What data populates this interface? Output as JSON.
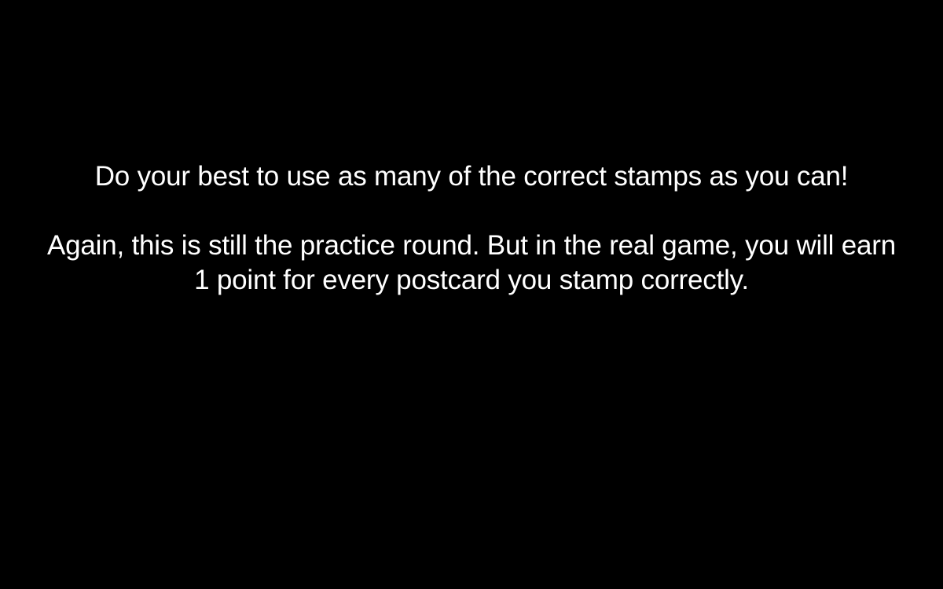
{
  "screen": {
    "background_color": "#000000",
    "text_color": "#ffffff",
    "instructions": {
      "line_1": "Do your best to use as many of the correct stamps as you can!",
      "line_2": "Again, this is still the practice round. But in the real game, you will earn",
      "line_3": "1 point for every postcard you stamp correctly."
    }
  }
}
